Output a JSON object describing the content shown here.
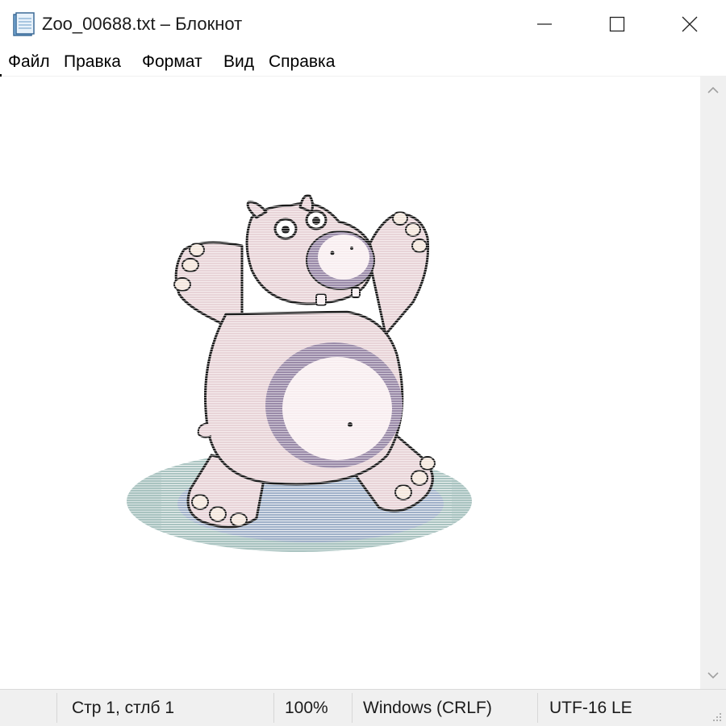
{
  "window": {
    "title": "Zoo_00688.txt – Блокнот",
    "app_icon": "notepad-icon",
    "controls": [
      "minimize-icon",
      "maximize-icon",
      "close-icon"
    ]
  },
  "menu": {
    "items": [
      {
        "label": "Файл"
      },
      {
        "label": "Правка"
      },
      {
        "label": "Формат"
      },
      {
        "label": "Вид"
      },
      {
        "label": "Справка"
      }
    ]
  },
  "editor": {
    "content_description_icon": "hippo-ascii-art"
  },
  "scrollbar": {
    "up_icon": "chevron-up-icon",
    "down_icon": "chevron-down-icon"
  },
  "status": {
    "position": "Стр 1, стлб 1",
    "zoom": "100%",
    "line_endings": "Windows (CRLF)",
    "encoding": "UTF-16 LE"
  },
  "colors": {
    "hippo_body": "#e8d4d8",
    "hippo_belly": "#f8eef0",
    "hippo_ring": "#9a8aa8",
    "shadow_outer": "#a9c3c0",
    "shadow_inner": "#9fb0c8",
    "outline": "#1a1a1a"
  }
}
